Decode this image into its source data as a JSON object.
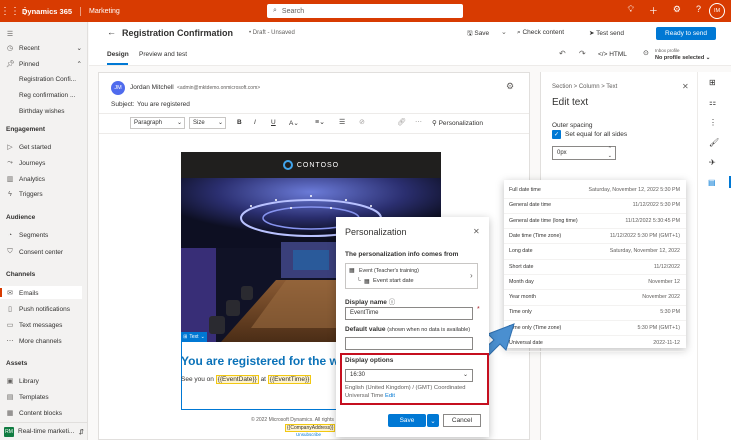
{
  "topbar": {
    "brand": "Dynamics 365",
    "area": "Marketing",
    "search_placeholder": "Search",
    "avatar": "IM"
  },
  "sidebar": {
    "recent": "Recent",
    "pinned": "Pinned",
    "pinned_items": [
      "Registration Confi...",
      "Reg confirmation ...",
      "Birthday wishes"
    ],
    "sections": [
      {
        "title": "Engagement",
        "items": [
          "Get started",
          "Journeys",
          "Analytics",
          "Triggers"
        ]
      },
      {
        "title": "Audience",
        "items": [
          "Segments",
          "Consent center"
        ]
      },
      {
        "title": "Channels",
        "items": [
          "Emails",
          "Push notifications",
          "Text messages",
          "More channels"
        ]
      },
      {
        "title": "Assets",
        "items": [
          "Library",
          "Templates",
          "Content blocks"
        ]
      }
    ],
    "selected": "Emails",
    "area_switcher": "Real-time marketi...",
    "area_badge": "RM"
  },
  "command_bar": {
    "title": "Registration Confirmation",
    "status": "Draft - Unsaved",
    "save": "Save",
    "check_content": "Check content",
    "test_send": "Test send",
    "ready_to_send": "Ready to send"
  },
  "tabs": {
    "design": "Design",
    "preview": "Preview and test",
    "html": "HTML",
    "profile_label": "Inbox profile",
    "profile_value": "No profile selected"
  },
  "email": {
    "from_initials": "JM",
    "from_name": "Jordan Mitchell",
    "from_address": "<admin@mktdemo.onmicrosoft.com>",
    "subject_label": "Subject:",
    "subject": "You are registered",
    "toolbar": {
      "paragraph": "Paragraph",
      "size": "Size",
      "personalization": "Personalization"
    },
    "brand_name": "CONTOSO",
    "text_tag": "Text",
    "headline": "You are registered for the w",
    "body_prefix": "See you on",
    "token_date": "{{EventDate}}",
    "body_at": "at",
    "token_time": "{{EventTime}}",
    "footer_copyright": "© 2022 Microsoft Dynamics. All rights",
    "footer_company": "{{CompanyAddress}}",
    "footer_unsub": "Unsubscribe"
  },
  "edit_text_panel": {
    "breadcrumb": "Section > Column > Text",
    "title": "Edit text",
    "outer_spacing": "Outer spacing",
    "set_equal": "Set equal for all sides",
    "spacing_value": "0px"
  },
  "personalization_dialog": {
    "title": "Personalization",
    "source_label": "The personalization info comes from",
    "source_line1": "Event (Teacher's training)",
    "source_line2": "Event start date",
    "display_name_label": "Display name",
    "display_name_value": "EventTime",
    "default_value_label": "Default value",
    "default_value_hint": "(shown when no data is available)",
    "display_options_label": "Display options",
    "display_option_value": "16:30",
    "locale_text": "English (United Kingdom) / (GMT) Coordinated Universal Time",
    "edit_link": "Edit",
    "save": "Save",
    "cancel": "Cancel"
  },
  "datetime_formats": [
    {
      "label": "Full date time",
      "value": "Saturday, November 12, 2022 5:30 PM"
    },
    {
      "label": "General date time",
      "value": "11/12/2022 5:30 PM"
    },
    {
      "label": "General date time (long time)",
      "value": "11/12/2022 5:30:45 PM"
    },
    {
      "label": "Date time (Time zone)",
      "value": "11/12/2022 5:30 PM (GMT+1)"
    },
    {
      "label": "Long date",
      "value": "Saturday, November 12, 2022"
    },
    {
      "label": "Short date",
      "value": "11/12/2022"
    },
    {
      "label": "Month day",
      "value": "November 12"
    },
    {
      "label": "Year month",
      "value": "November 2022"
    },
    {
      "label": "Time only",
      "value": "5:30 PM"
    },
    {
      "label": "Time only (Time zone)",
      "value": "5:30 PM (GMT+1)"
    },
    {
      "label": "Universal date",
      "value": "2022-11-12"
    }
  ],
  "colors": {
    "brand": "#d83b01",
    "primary": "#0078d4",
    "highlight_border": "#c50f1f",
    "headline": "#0b72b8",
    "arrow": "#4a8fd0"
  }
}
